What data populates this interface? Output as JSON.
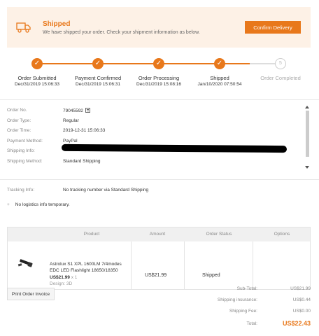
{
  "banner": {
    "title": "Shipped",
    "subtitle": "We have shipped your order. Check your shipment information as below.",
    "confirm_label": "Confirm Delivery",
    "accent_color": "#e8781b"
  },
  "progress": {
    "steps": [
      {
        "label": "Order Submitted",
        "date": "Dec/31/2019 15:06:33",
        "done": true,
        "mark": "✓"
      },
      {
        "label": "Payment Confirmed",
        "date": "Dec/31/2019 15:06:31",
        "done": true,
        "mark": "✓"
      },
      {
        "label": "Order Processing",
        "date": "Dec/31/2019 15:08:16",
        "done": true,
        "mark": "✓"
      },
      {
        "label": "Shipped",
        "date": "Jan/10/2020 07:50:54",
        "done": true,
        "mark": "✓"
      },
      {
        "label": "Order Completed",
        "date": "",
        "done": false,
        "mark": "5"
      }
    ]
  },
  "order_info": {
    "order_no": {
      "label": "Order No.",
      "value": "79045592"
    },
    "order_type": {
      "label": "Order Type:",
      "value": "Regular"
    },
    "order_time": {
      "label": "Order Time:",
      "value": "2019-12-31 15:06:33"
    },
    "payment_method": {
      "label": "Payment Method:",
      "value": "PayPal"
    },
    "shipping_info": {
      "label": "Shipping Info:",
      "value": ""
    },
    "shipping_method": {
      "label": "Shipping Method:",
      "value": "Standard Shipping"
    }
  },
  "tracking": {
    "label": "Tracking Info:",
    "value": "No tracking number via Standard Shipping",
    "logistics": "No logistics info temporary."
  },
  "table": {
    "headers": {
      "product": "Product",
      "amount": "Amount",
      "status": "Order Status",
      "options": "Options"
    },
    "row": {
      "name": "Astrolux S1 XPL 1600LM 7/4modes EDC LED Flashlight 18650/18350",
      "price": "US$21.99",
      "qty": "x 1",
      "design": "Design: 3D",
      "amount": "US$21.99",
      "status": "Shipped"
    }
  },
  "print_label": "Print Order Invoice",
  "summary": {
    "subtotal": {
      "label": "Sub-Total:",
      "value": "US$21.99"
    },
    "insurance": {
      "label": "Shipping insurance:",
      "value": "US$0.44"
    },
    "fee": {
      "label": "Shipping Fee:",
      "value": "US$0.00"
    },
    "total": {
      "label": "Total:",
      "value": "US$22.43"
    }
  }
}
